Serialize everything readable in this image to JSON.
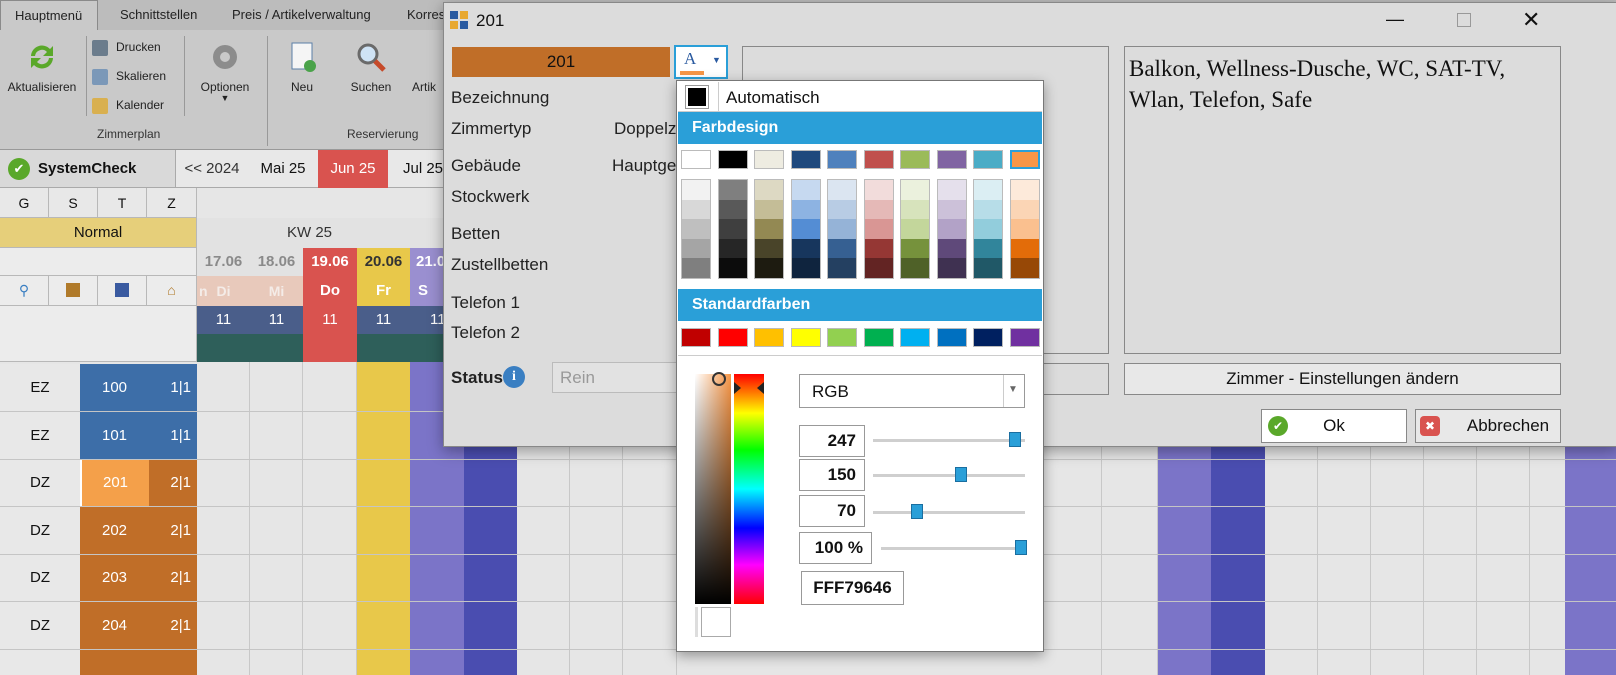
{
  "ribbon": {
    "tabs": [
      "Hauptmenü",
      "Schnittstellen",
      "Preis / Artikelverwaltung",
      "Korres"
    ],
    "refresh_label": "Aktualisieren",
    "print_label": "Drucken",
    "scale_label": "Skalieren",
    "calendar_label": "Kalender",
    "options_label": "Optionen",
    "new_label": "Neu",
    "search_label": "Suchen",
    "article_label": "Artik",
    "group_roomplan": "Zimmerplan",
    "group_reservation": "Reservierung"
  },
  "planner": {
    "systemcheck": "SystemCheck",
    "months": [
      "<< 2024",
      "Mai 25",
      "Jun 25",
      "Jul 25"
    ],
    "col_headers": [
      "G",
      "S",
      "T",
      "Z"
    ],
    "season": "Normal",
    "week": "KW 25",
    "dates": [
      "17.06",
      "18.06",
      "19.06",
      "20.06",
      "21.0"
    ],
    "weekdays": [
      "Di",
      "Mi",
      "Do",
      "Fr",
      "S"
    ],
    "prev_weekday_partial": "n",
    "counts": [
      "11",
      "11",
      "11",
      "11",
      "11"
    ],
    "rooms": [
      {
        "type": "EZ",
        "number": "100",
        "beds": "1|1"
      },
      {
        "type": "EZ",
        "number": "101",
        "beds": "1|1"
      },
      {
        "type": "DZ",
        "number": "201",
        "beds": "2|1"
      },
      {
        "type": "DZ",
        "number": "202",
        "beds": "2|1"
      },
      {
        "type": "DZ",
        "number": "203",
        "beds": "2|1"
      },
      {
        "type": "DZ",
        "number": "204",
        "beds": "2|1"
      }
    ]
  },
  "dialog": {
    "title": "201",
    "room_number": "201",
    "labels": {
      "bezeichnung": "Bezeichnung",
      "zimmertyp": "Zimmertyp",
      "zimmertyp_value": "Doppelz",
      "gebaeude": "Gebäude",
      "gebaeude_value": "Hauptge",
      "stockwerk": "Stockwerk",
      "betten": "Betten",
      "zustellbetten": "Zustellbetten",
      "telefon1": "Telefon 1",
      "telefon2": "Telefon 2",
      "status": "Status"
    },
    "status_value": "Rein",
    "description": "Balkon, Wellness-Dusche, WC, SAT-TV, Wlan, Telefon, Safe",
    "change_settings": "Zimmer - Einstellungen ändern",
    "ok": "Ok",
    "cancel": "Abbrechen"
  },
  "color_picker": {
    "auto_label": "Automatisch",
    "design_header": "Farbdesign",
    "standard_header": "Standardfarben",
    "design_colors": [
      "#ffffff",
      "#000000",
      "#eeece1",
      "#1f497d",
      "#4f81bd",
      "#c0504d",
      "#9bbb59",
      "#8064a2",
      "#4bacc6",
      "#f79646"
    ],
    "shades": [
      [
        "#f2f2f2",
        "#d8d8d8",
        "#bfbfbf",
        "#a5a5a5",
        "#7f7f7f"
      ],
      [
        "#7f7f7f",
        "#595959",
        "#3f3f3f",
        "#262626",
        "#0c0c0c"
      ],
      [
        "#ddd9c3",
        "#c4bd97",
        "#938953",
        "#494429",
        "#1d1b10"
      ],
      [
        "#c6d9f0",
        "#8db3e2",
        "#548dd4",
        "#17365d",
        "#0f243e"
      ],
      [
        "#dbe5f1",
        "#b8cce4",
        "#95b3d7",
        "#366092",
        "#244061"
      ],
      [
        "#f2dcdb",
        "#e5b9b7",
        "#d99694",
        "#953734",
        "#632423"
      ],
      [
        "#ebf1dd",
        "#d7e3bc",
        "#c3d69b",
        "#76923c",
        "#4f6128"
      ],
      [
        "#e5e0ec",
        "#ccc1d9",
        "#b2a2c7",
        "#5f497a",
        "#3f3151"
      ],
      [
        "#dbeef3",
        "#b7dde8",
        "#92cddc",
        "#31859b",
        "#205867"
      ],
      [
        "#fdeada",
        "#fbd5b5",
        "#fac08f",
        "#e36c09",
        "#974806"
      ]
    ],
    "standard_colors": [
      "#c00000",
      "#ff0000",
      "#ffc000",
      "#ffff00",
      "#92d050",
      "#00b050",
      "#00b0f0",
      "#0070c0",
      "#002060",
      "#7030a0"
    ],
    "mode": "RGB",
    "r": "247",
    "g": "150",
    "b": "70",
    "alpha": "100 %",
    "r_value": 247,
    "g_value": 150,
    "b_value": 70,
    "alpha_value": 100,
    "hex": "FFF79646",
    "selected_color": "#f79646"
  }
}
